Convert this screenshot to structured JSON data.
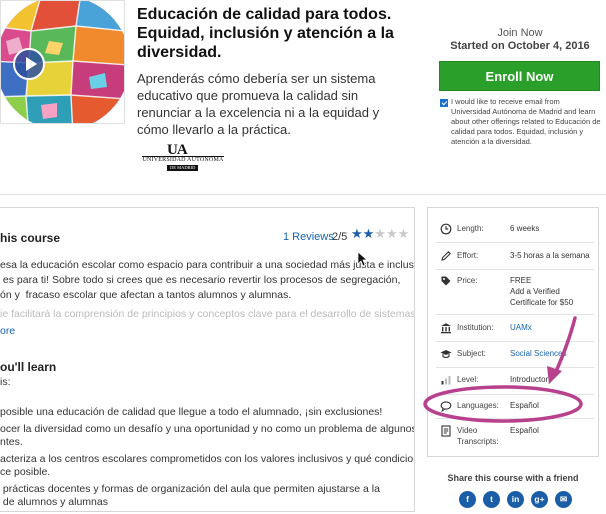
{
  "course": {
    "title": "Educación de calidad para todos. Equidad, inclusión y atención a la diversidad.",
    "description": "Aprenderás cómo debería ser un sistema educativo que promueva la calidad sin renunciar a la excelencia ni a la equidad y cómo llevarlo a la práctica."
  },
  "logo": {
    "mark": "UA",
    "name": "UNIVERSIDAD AUTONOMA",
    "sub": "DE MADRID"
  },
  "enrollment": {
    "join_label": "Join Now",
    "start_date": "Started on October 4, 2016",
    "enroll_label": "Enroll Now",
    "optin_text": "I would like to receive email from Universidad Autónoma de Madrid and learn about other offerings related to Educación de calidad para todos. Equidad, inclusión y atención a la diversidad.",
    "optin_checked": true
  },
  "about": {
    "heading": "his course",
    "reviews_link": "1 Reviews",
    "rating": "2/5",
    "text": "esa la educación escolar como espacio para contribuir a una sociedad más justa e inclusiva,\n es para ti! Sobre todo si crees que es necesario revertir los procesos de segregación,\nón y  fracaso escolar que afectan a tantos alumnos y alumnas.",
    "faded_text": "ie facilitará la comprensión de principios y conceptos clave para el desarrollo de sistemas",
    "see_more": "ore"
  },
  "learn": {
    "heading": "ou'll learn",
    "intro": "is:",
    "items": [
      "posible una educación de calidad que llegue a todo el alumnado, ¡sin exclusiones!",
      "ocer la diversidad como un desafío y una oportunidad y no como un problema de algunos\nntes.",
      "acteriza a los centros escolares comprometidos con los valores inclusivos y qué condiciones\nce posible.",
      " prácticas docentes y formas de organización del aula que permiten ajustarse a la\n de alumnos y alumnas"
    ]
  },
  "details": [
    {
      "icon": "clock-icon",
      "label": "Length:",
      "value": "6 weeks",
      "link": false
    },
    {
      "icon": "pencil-icon",
      "label": "Effort:",
      "value": "3-5 horas a la semana",
      "link": false
    },
    {
      "icon": "price-tag-icon",
      "label": "Price:",
      "value": "FREE\nAdd a Verified\nCertificate for $50",
      "link": false
    },
    {
      "icon": "institution-icon",
      "label": "Institution:",
      "value": "UAMx",
      "link": true
    },
    {
      "icon": "graduation-cap-icon",
      "label": "Subject:",
      "value": "Social Sciences",
      "link": true
    },
    {
      "icon": "level-bars-icon",
      "label": "Level:",
      "value": "Introductory",
      "link": false
    },
    {
      "icon": "speech-bubble-icon",
      "label": "Languages:",
      "value": "Español",
      "link": false
    },
    {
      "icon": "transcript-icon",
      "label": "Video\nTranscripts:",
      "value": "Español",
      "link": false
    }
  ],
  "share": {
    "label": "Share this course with a friend",
    "buttons": [
      {
        "icon": "facebook-icon",
        "glyph": "f"
      },
      {
        "icon": "twitter-icon",
        "glyph": "t"
      },
      {
        "icon": "linkedin-icon",
        "glyph": "in"
      },
      {
        "icon": "google-plus-icon",
        "glyph": "g+"
      },
      {
        "icon": "email-icon",
        "glyph": "✉"
      }
    ]
  },
  "colors": {
    "enroll_green": "#2aa02a",
    "link_blue": "#1a64b0",
    "social_blue": "#1a5ea8",
    "annotation_magenta": "#b8418e"
  }
}
